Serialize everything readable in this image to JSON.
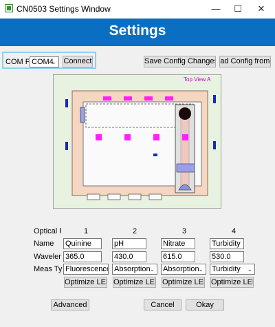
{
  "window": {
    "title": "CN0503 Settings Window",
    "minimize": "—",
    "maximize": "☐",
    "close": "✕"
  },
  "header": {
    "title": "Settings",
    "color": "#0a6fc2"
  },
  "com": {
    "label": "COM Po",
    "port": "COM4",
    "connect": "Connect"
  },
  "config": {
    "save": "Save Config Changes to File",
    "load": "Load Config from File"
  },
  "diagram": {
    "label": "Top View A"
  },
  "optical": {
    "header_label": "Optical Pat",
    "name_label": "Name",
    "wavelength_label": "Wavelength",
    "meas_label": "Meas Type",
    "optimize_label": "Optimize LED",
    "paths": [
      {
        "num": "1",
        "name": "Quinine",
        "wavelength": "365.0",
        "meas": "Fluorescence"
      },
      {
        "num": "2",
        "name": "pH",
        "wavelength": "430.0",
        "meas": "Absorption"
      },
      {
        "num": "3",
        "name": "Nitrate",
        "wavelength": "615.0",
        "meas": "Absorption"
      },
      {
        "num": "4",
        "name": "Turbidity",
        "wavelength": "530.0",
        "meas": "Turbidity"
      }
    ]
  },
  "footer": {
    "advanced": "Advanced",
    "cancel": "Cancel",
    "okay": "Okay"
  }
}
